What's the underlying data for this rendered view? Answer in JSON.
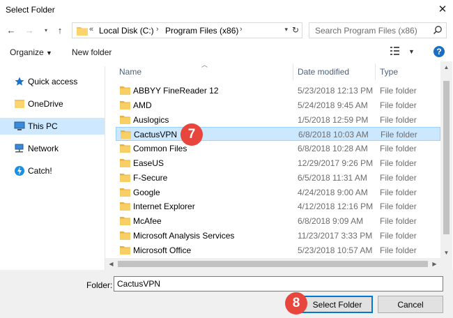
{
  "window": {
    "title": "Select Folder"
  },
  "address": {
    "overflow": "«",
    "crumbs": [
      "Local Disk (C:)",
      "Program Files (x86)"
    ]
  },
  "search": {
    "placeholder": "Search Program Files (x86)"
  },
  "commands": {
    "organize": "Organize",
    "new_folder": "New folder",
    "help": "?"
  },
  "sidebar": {
    "items": [
      {
        "label": "Quick access",
        "icon": "star-icon"
      },
      {
        "label": "OneDrive",
        "icon": "folder-icon"
      },
      {
        "label": "This PC",
        "icon": "monitor-icon",
        "selected": true
      },
      {
        "label": "Network",
        "icon": "network-icon"
      },
      {
        "label": "Catch!",
        "icon": "lightning-icon"
      }
    ]
  },
  "columns": {
    "name": "Name",
    "date": "Date modified",
    "type": "Type"
  },
  "rows": [
    {
      "name": "ABBYY FineReader 12",
      "date": "5/23/2018 12:13 PM",
      "type": "File folder"
    },
    {
      "name": "AMD",
      "date": "5/24/2018 9:45 AM",
      "type": "File folder"
    },
    {
      "name": "Auslogics",
      "date": "1/5/2018 12:59 PM",
      "type": "File folder"
    },
    {
      "name": "CactusVPN",
      "date": "6/8/2018 10:03 AM",
      "type": "File folder",
      "selected": true
    },
    {
      "name": "Common Files",
      "date": "6/8/2018 10:28 AM",
      "type": "File folder"
    },
    {
      "name": "EaseUS",
      "date": "12/29/2017 9:26 PM",
      "type": "File folder"
    },
    {
      "name": "F-Secure",
      "date": "6/5/2018 11:31 AM",
      "type": "File folder"
    },
    {
      "name": "Google",
      "date": "4/24/2018 9:00 AM",
      "type": "File folder"
    },
    {
      "name": "Internet Explorer",
      "date": "4/12/2018 12:16 PM",
      "type": "File folder"
    },
    {
      "name": "McAfee",
      "date": "6/8/2018 9:09 AM",
      "type": "File folder"
    },
    {
      "name": "Microsoft Analysis Services",
      "date": "11/23/2017 3:33 PM",
      "type": "File folder"
    },
    {
      "name": "Microsoft Office",
      "date": "5/23/2018 10:57 AM",
      "type": "File folder"
    }
  ],
  "footer": {
    "folder_label": "Folder:",
    "folder_value": "CactusVPN",
    "select_button": "Select Folder",
    "cancel_button": "Cancel"
  },
  "annotations": {
    "step_7": "7",
    "step_8": "8",
    "color": "#e8453c"
  },
  "colors": {
    "selection": "#cce8ff",
    "accent": "#0078d7",
    "folder": "#f7c25c"
  }
}
